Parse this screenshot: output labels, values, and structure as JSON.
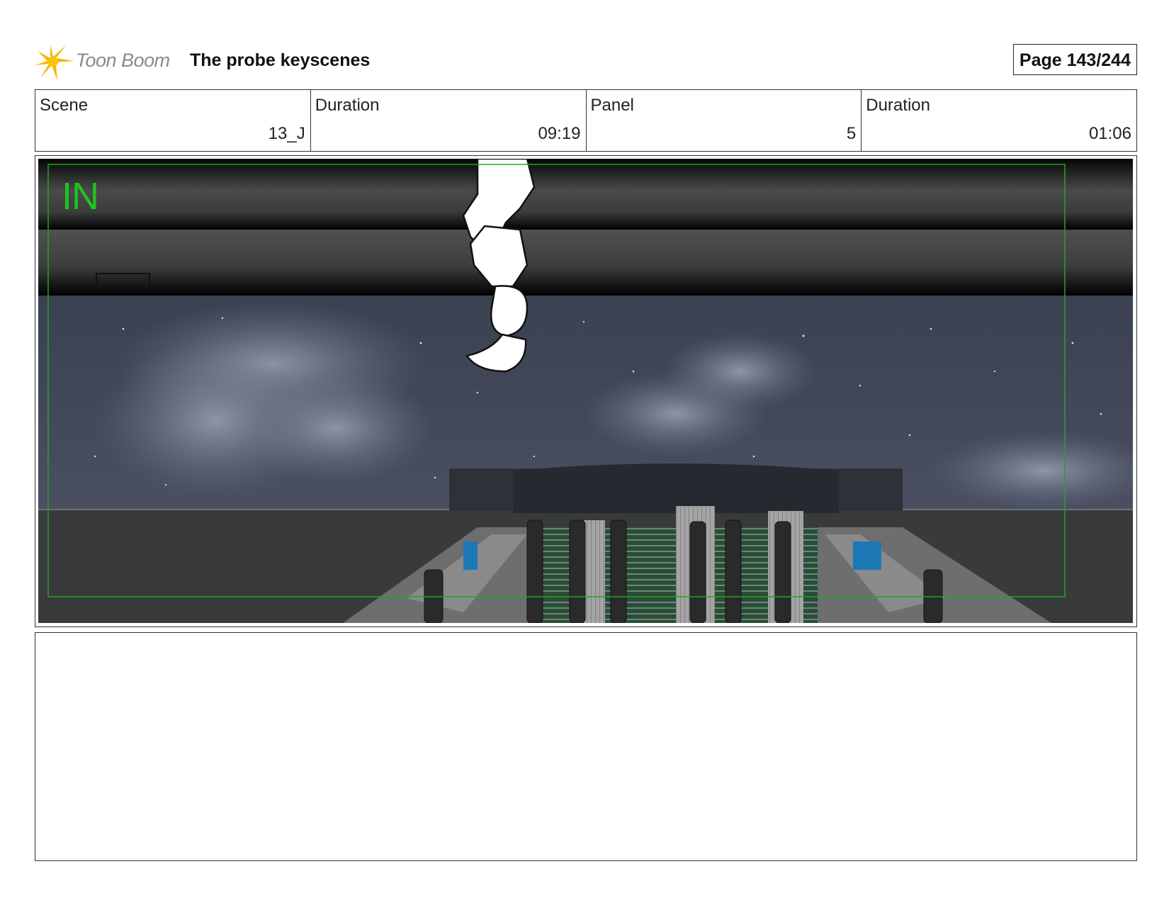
{
  "header": {
    "logo_text": "Toon Boom",
    "project_title": "The probe keyscenes",
    "page_label": "Page 143/244"
  },
  "info": {
    "scene_label": "Scene",
    "scene_value": "13_J",
    "scene_duration_label": "Duration",
    "scene_duration_value": "09:19",
    "panel_label": "Panel",
    "panel_value": "5",
    "panel_duration_label": "Duration",
    "panel_duration_value": "01:06"
  },
  "panel": {
    "overlay_label": "IN"
  },
  "colors": {
    "safe_area": "#1fa81f",
    "logo_yellow": "#f5b800"
  }
}
